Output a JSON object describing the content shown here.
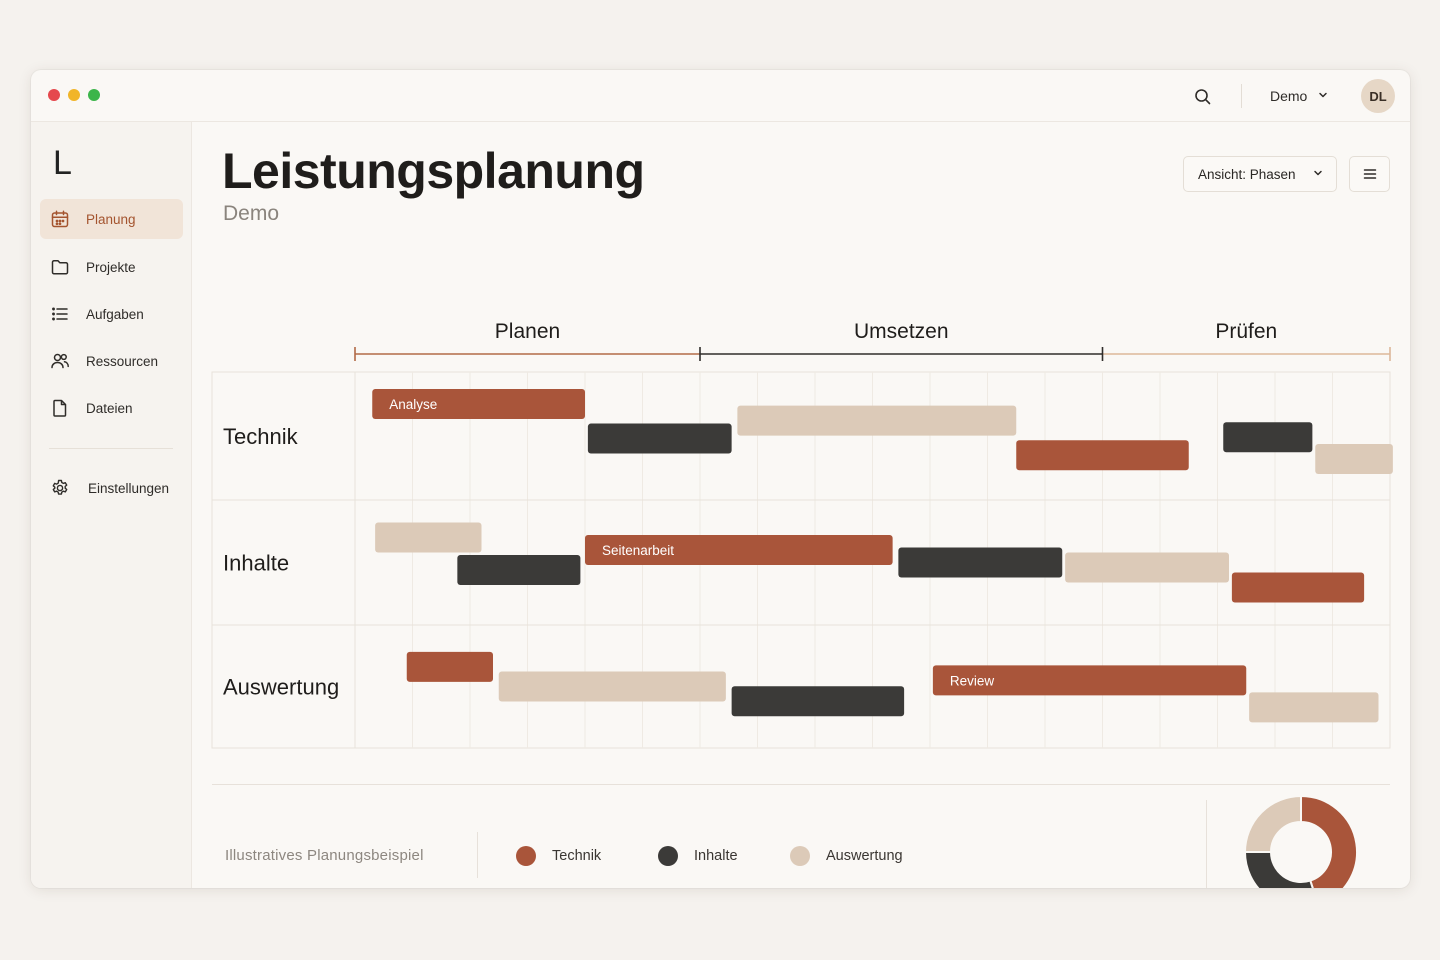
{
  "window": {
    "user": {
      "name": "Demo",
      "initials": "DL"
    }
  },
  "sidebar": {
    "logo": "L",
    "items": [
      {
        "label": "Planung",
        "icon": "calendar-icon",
        "active": true
      },
      {
        "label": "Projekte",
        "icon": "folder-icon",
        "active": false
      },
      {
        "label": "Aufgaben",
        "icon": "list-icon",
        "active": false
      },
      {
        "label": "Ressourcen",
        "icon": "users-icon",
        "active": false
      },
      {
        "label": "Dateien",
        "icon": "file-icon",
        "active": false
      }
    ],
    "settings": {
      "label": "Einstellungen",
      "icon": "gear-icon"
    }
  },
  "header": {
    "title": "Leistungsplanung",
    "subtitle": "Demo",
    "view_select": "Ansicht: Phasen"
  },
  "colors": {
    "technik": "#a9553a",
    "inhalte": "#3b3a38",
    "auswertung": "#dccab8",
    "accent": "#a4542f"
  },
  "chart_data": {
    "type": "gantt",
    "time_units": 18,
    "phases": [
      {
        "label": "Planen",
        "start": 0,
        "end": 6,
        "color": "#b26a46"
      },
      {
        "label": "Umsetzen",
        "start": 6,
        "end": 13,
        "color": "#2f2d2b"
      },
      {
        "label": "Prüfen",
        "start": 13,
        "end": 18,
        "color": "#dcb79a"
      }
    ],
    "rows": [
      {
        "label": "Technik",
        "bars": [
          {
            "cat": "technik",
            "start": 0.3,
            "end": 4.0,
            "lane": 0.25,
            "label": "Analyse"
          },
          {
            "cat": "inhalte",
            "start": 4.05,
            "end": 6.55,
            "lane": 0.52
          },
          {
            "cat": "auswertung",
            "start": 6.65,
            "end": 11.5,
            "lane": 0.38
          },
          {
            "cat": "technik",
            "start": 11.5,
            "end": 14.5,
            "lane": 0.65
          },
          {
            "cat": "inhalte",
            "start": 15.1,
            "end": 16.65,
            "lane": 0.51
          },
          {
            "cat": "auswertung",
            "start": 16.7,
            "end": 18.05,
            "lane": 0.68
          }
        ]
      },
      {
        "label": "Inhalte",
        "bars": [
          {
            "cat": "auswertung",
            "start": 0.35,
            "end": 2.2,
            "lane": 0.3
          },
          {
            "cat": "inhalte",
            "start": 1.78,
            "end": 3.92,
            "lane": 0.56
          },
          {
            "cat": "technik",
            "start": 4.0,
            "end": 9.35,
            "lane": 0.4,
            "label": "Seitenarbeit"
          },
          {
            "cat": "inhalte",
            "start": 9.45,
            "end": 12.3,
            "lane": 0.5
          },
          {
            "cat": "auswertung",
            "start": 12.35,
            "end": 15.2,
            "lane": 0.54
          },
          {
            "cat": "technik",
            "start": 15.25,
            "end": 17.55,
            "lane": 0.7
          }
        ]
      },
      {
        "label": "Auswertung",
        "bars": [
          {
            "cat": "technik",
            "start": 0.9,
            "end": 2.4,
            "lane": 0.34
          },
          {
            "cat": "auswertung",
            "start": 2.5,
            "end": 6.45,
            "lane": 0.5
          },
          {
            "cat": "inhalte",
            "start": 6.55,
            "end": 9.55,
            "lane": 0.62
          },
          {
            "cat": "technik",
            "start": 10.05,
            "end": 15.5,
            "lane": 0.45,
            "label": "Review"
          },
          {
            "cat": "auswertung",
            "start": 15.55,
            "end": 17.8,
            "lane": 0.67
          }
        ]
      }
    ],
    "legend": [
      {
        "label": "Technik",
        "cat": "technik"
      },
      {
        "label": "Inhalte",
        "cat": "inhalte"
      },
      {
        "label": "Auswertung",
        "cat": "auswertung"
      }
    ],
    "donut": [
      {
        "cat": "technik",
        "value": 45
      },
      {
        "cat": "inhalte",
        "value": 30
      },
      {
        "cat": "auswertung",
        "value": 25
      }
    ]
  },
  "footer": {
    "note": "Illustratives Planungsbeispiel"
  }
}
